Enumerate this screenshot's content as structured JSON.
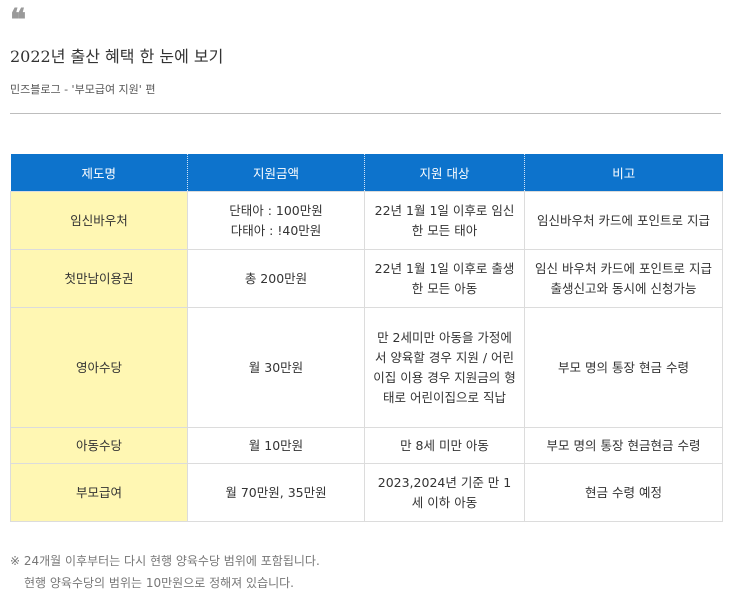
{
  "header": {
    "quote_mark": "❝",
    "title": "2022년 출산 혜택 한 눈에 보기",
    "subtitle": "민즈블로그 - '부모급여 지원' 편"
  },
  "table": {
    "headers": [
      "제도명",
      "지원금액",
      "지원 대상",
      "비고"
    ],
    "rows": [
      {
        "name": "임신바우처",
        "amount": "단태아 : 100만원\n다태아 : !40만원",
        "target": "22년 1월 1일 이후로 임신한 모든 태아",
        "note": "임신바우처 카드에 포인트로 지급"
      },
      {
        "name": "첫만남이용권",
        "amount": "총 200만원",
        "target": "22년 1월 1일 이후로 출생한 모든 아동",
        "note": "임신 바우처 카드에 포인트로 지급\n출생신고와 동시에 신청가능"
      },
      {
        "name": "영아수당",
        "amount": "월 30만원",
        "target": "만 2세미만 아동을 가정에서 양육할 경우 지원 / 어린이집 이용 경우 지원금의 형태로 어린이집으로 직납",
        "note": "부모 명의 통장 현금 수령"
      },
      {
        "name": "아동수당",
        "amount": "월 10만원",
        "target": "만 8세 미만 아동",
        "note": "부모 명의 통장 현금현금 수령"
      },
      {
        "name": "부모급여",
        "amount": "월 70만원, 35만원",
        "target": "2023,2024년 기준 만 1세 이하 아동",
        "note": "현금 수령 예정"
      }
    ]
  },
  "footnote": {
    "line1": "※ 24개월 이후부터는 다시 현행 양육수당 범위에 포함됩니다.",
    "line2": "현행 양육수당의 범위는 10만원으로 정해져 있습니다."
  },
  "colors": {
    "header_bg": "#0d73cc",
    "name_cell_bg": "#fff7b3"
  }
}
